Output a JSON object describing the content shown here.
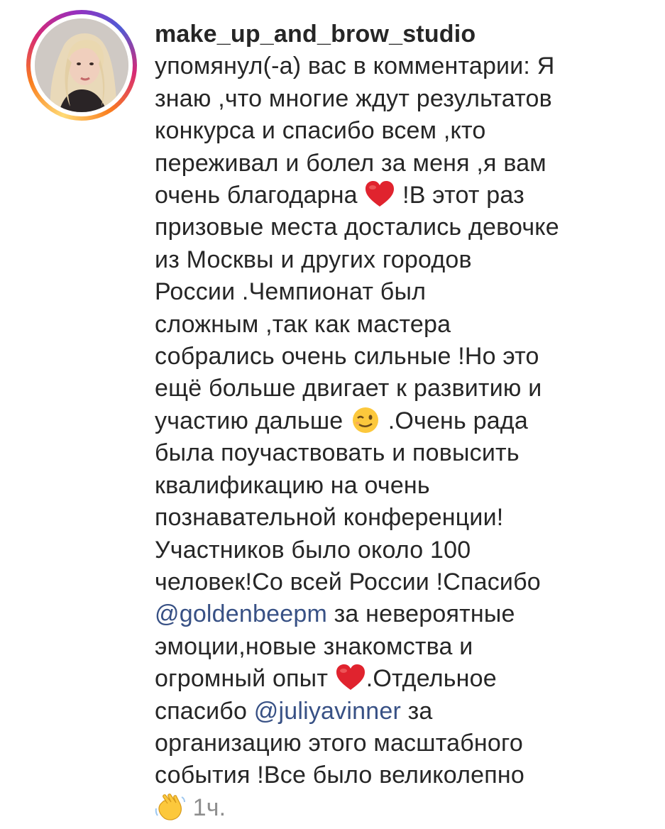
{
  "notification": {
    "username": "make_up_and_brow_studio",
    "lines": [
      "упомянул(-а) вас в комментарии: Я",
      "знаю ,что многие ждут результатов",
      "конкурса и спасибо всем ,кто",
      "переживал и болел за меня ,я вам",
      "очень благодарна",
      "!В этот раз",
      "призовые места достались девочке",
      "из Москвы и других городов",
      "России .Чемпионат был",
      "сложным ,так как мастера",
      "собрались очень сильные !Но это",
      "ещё больше двигает к развитию и",
      "участию дальше",
      ".Очень рада",
      "была поучаствовать и повысить",
      "квалификацию на очень",
      "познавательной конференции!",
      "Участников было около 100",
      "человек!Со всей России !Спасибо",
      "за невероятные",
      "эмоции,новые знакомства и",
      "огромный опыт",
      ".Отдельное",
      "спасибо",
      "за",
      "организацию этого масштабного",
      "события !Все было великолепно"
    ],
    "mentions": [
      "@goldenbeepm",
      "@juliyavinner"
    ],
    "time": "1ч.",
    "icons": [
      "heart-emoji-icon",
      "wink-emoji-icon",
      "waving-hand-emoji-icon"
    ],
    "colors": {
      "text": "#262626",
      "mention": "#385185",
      "time": "#8e8e8e",
      "heart": "#e0232e"
    }
  }
}
